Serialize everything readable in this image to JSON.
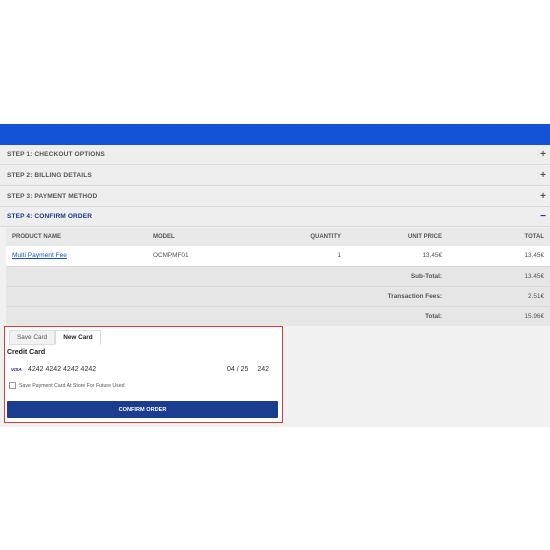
{
  "steps": [
    {
      "label": "Step 1: Checkout Options",
      "sign": "+"
    },
    {
      "label": "Step 2: Billing Details",
      "sign": "+"
    },
    {
      "label": "Step 3: Payment Method",
      "sign": "+"
    },
    {
      "label": "Step 4: Confirm Order",
      "sign": "−"
    }
  ],
  "cart": {
    "headers": [
      "Product Name",
      "Model",
      "Quantity",
      "Unit Price",
      "Total"
    ],
    "row": {
      "name": "Multi Payment Fee",
      "model": "OCMPMF01",
      "quantity": "1",
      "unit_price": "13.45€",
      "total": "13.45€"
    },
    "totals": [
      {
        "label": "Sub-Total:",
        "value": "13.45€"
      },
      {
        "label": "Transaction Fees:",
        "value": "2.51€"
      },
      {
        "label": "Total:",
        "value": "15.96€"
      }
    ]
  },
  "payment": {
    "tabs": [
      "Save Card",
      "New Card"
    ],
    "title": "Credit Card",
    "card_brand": "VISA",
    "card_number": "4242 4242 4242 4242",
    "expiry": "04 / 25",
    "cvc": "242",
    "save_label": "Save Payment Card At Store For Future Used",
    "confirm_label": "Confirm Order"
  },
  "colors": {
    "topbar": "#1553d6",
    "confirm_button": "#1b3d8f",
    "highlight_border": "#e53935"
  }
}
